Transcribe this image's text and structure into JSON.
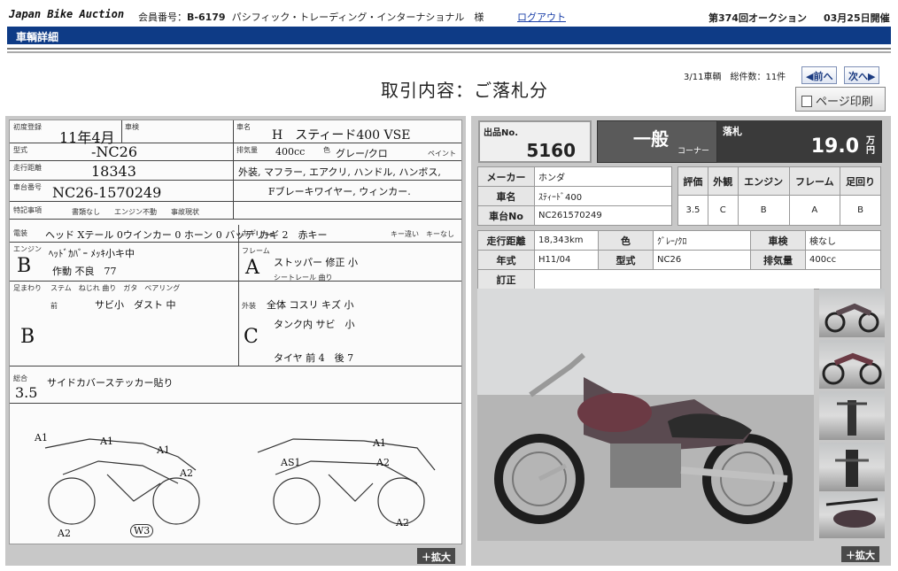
{
  "header": {
    "logo": "Japan Bike Auction",
    "member_label": "会員番号：",
    "member_id": "B-6179",
    "member_name": "パシフィック・トレーディング・インターナショナル　様",
    "logout": "ログアウト",
    "auction_no": "第374回オークション",
    "auction_date": "03月25日開催"
  },
  "navbar": {
    "title": "車輌詳細"
  },
  "page": {
    "title": "取引内容：ご落札分",
    "vehicle_count": "3/11車輌　総件数：11件",
    "prev": "◀前へ",
    "next": "次へ▶",
    "print": "ページ印刷"
  },
  "lot": {
    "label": "出品No.",
    "number": "5160",
    "corner_main": "一般",
    "corner_sub": "コーナー",
    "bid_label": "落札",
    "bid_value": "19.0",
    "bid_unit": "万円"
  },
  "specs": {
    "maker_label": "メーカー",
    "maker": "ホンダ",
    "name_label": "車名",
    "name": "ｽﾃｨｰﾄﾞ400",
    "frame_label": "車台No",
    "frame_no": "NC261570249",
    "mileage_label": "走行距離",
    "mileage": "18,343km",
    "color_label": "色",
    "color": "ｸﾞﾚｰ/ｸﾛ",
    "inspection_label": "車検",
    "inspection": "検なし",
    "year_label": "年式",
    "year": "H11/04",
    "model_label": "型式",
    "model": "NC26",
    "displacement_label": "排気量",
    "displacement": "400cc",
    "correction_label": "訂正",
    "correction": ""
  },
  "grades": {
    "headers": [
      "評価",
      "外観",
      "エンジン",
      "フレーム",
      "足回り"
    ],
    "values": [
      "3.5",
      "C",
      "B",
      "A",
      "B"
    ]
  },
  "sheet": {
    "first_reg_label": "初度登録",
    "first_reg": "11年4月",
    "inspection_label": "車検",
    "name_label": "車名",
    "name": "H　スティード400 VSE",
    "model_label": "型式",
    "model": "-NC26",
    "displacement_label": "排気量",
    "displacement": "400cc",
    "color_label": "色",
    "color": "グレー/クロ",
    "paint_label": "ペイント",
    "mileage_label": "走行距離",
    "mileage": "18343",
    "options": "外装, マフラー, エアクリ, ハンドル, ハンボス,",
    "options2": "Fブレーキワイヤー, ウィンカー.",
    "frame_label": "車台番号",
    "frame_no": "NC26-1570249",
    "special_label": "特記事項",
    "special_opts": "書類なし　　エンジン不動　　事故現状",
    "electric_label": "電装",
    "electric": "ヘッド Xテール 0ウインカー 0 ホーン 0 バッテリー",
    "key_label": "カギ",
    "key": "カギ 2　赤キー",
    "key_opts": "キー違い　キーなし",
    "engine_label": "エンジン",
    "engine_grade": "B",
    "engine_note": "ﾍｯﾄﾞｶﾊﾞｰ ﾒｯｷ小キ中",
    "engine_note2": "作動 不良　77",
    "frame2_label": "フレーム",
    "frame_grade": "A",
    "stopper_note": "ストッパー 修正 小",
    "seat_rail": "シートレール 曲り",
    "suspension_label": "足まわり",
    "susp_notes": "ステム　ねじれ 曲り　ガタ　ベアリング",
    "front_label": "前",
    "front_note": "サビ小　ダスト 中",
    "suspension_grade": "B",
    "exterior_label": "外装",
    "exterior_grade": "C",
    "exterior_note": "全体 コスリ キズ 小",
    "tank_note": "タンク内 サビ　小",
    "tire_note": "タイヤ 前 4　後 7",
    "total_label": "総合",
    "total_grade": "3.5",
    "total_note": "サイドカバーステッカー貼り",
    "diagram_marks": [
      "A1",
      "A1",
      "A2",
      "A2",
      "W3",
      "A1",
      "A2",
      "AS1",
      "A1",
      "A2"
    ]
  },
  "actions": {
    "expand": "＋拡大"
  }
}
